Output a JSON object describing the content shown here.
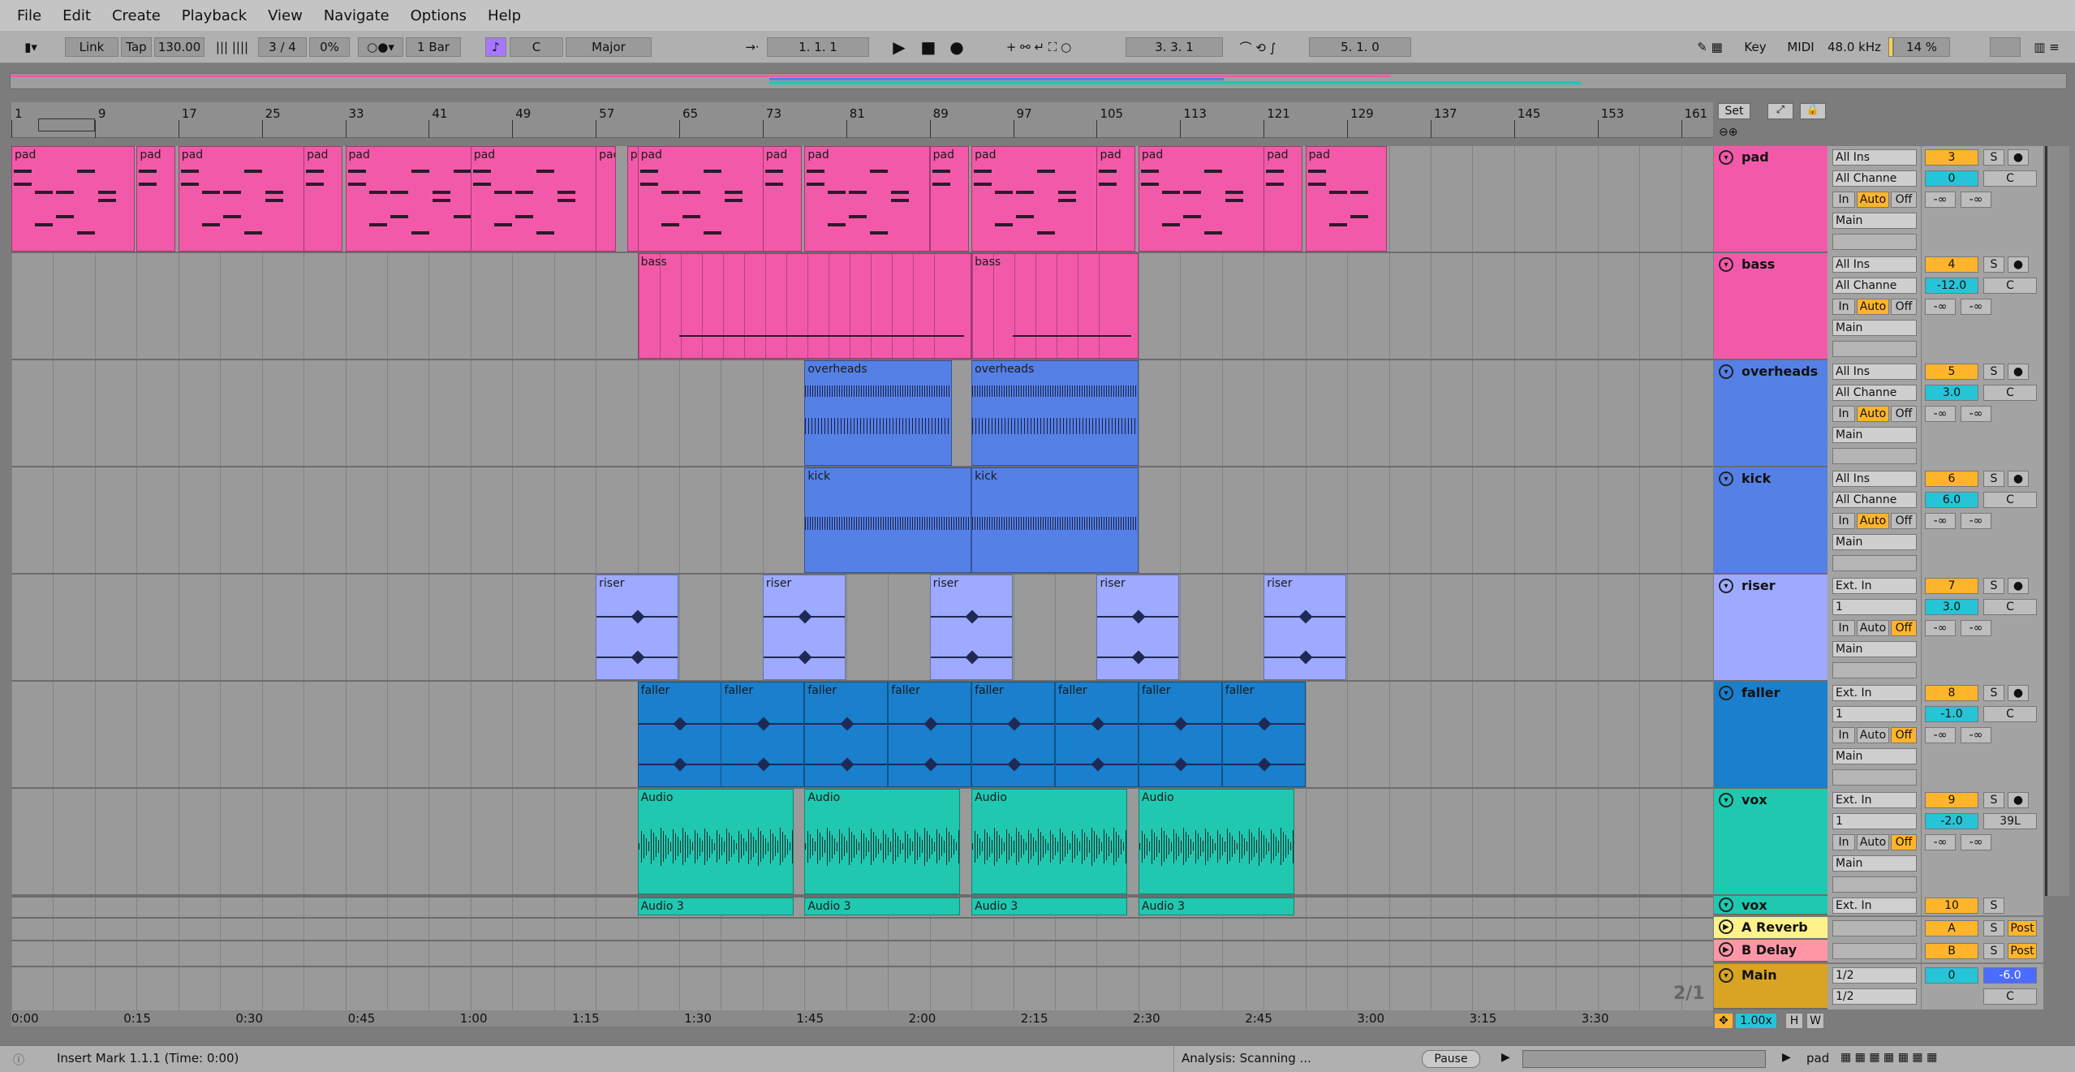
{
  "menu": [
    "File",
    "Edit",
    "Create",
    "Playback",
    "View",
    "Navigate",
    "Options",
    "Help"
  ],
  "toolbar": {
    "link": "Link",
    "tap": "Tap",
    "tempo": "130.00",
    "signature": "3 / 4",
    "groove": "0%",
    "quantize": "1 Bar",
    "key": "C",
    "scale": "Major",
    "position": "1.   1.   1",
    "loop_start": "3.   3.   1",
    "loop_length": "5.   1.   0",
    "key_map": "Key",
    "midi_map": "MIDI",
    "sample_rate": "48.0 kHz",
    "cpu": "14 %"
  },
  "ruler": {
    "bars": [
      "1",
      "9",
      "17",
      "25",
      "33",
      "41",
      "49",
      "57",
      "65",
      "73",
      "81",
      "89",
      "97",
      "105",
      "113",
      "121",
      "129",
      "137",
      "145",
      "153",
      "161"
    ],
    "set_label": "Set"
  },
  "timeline": [
    "0:00",
    "0:15",
    "0:30",
    "0:45",
    "1:00",
    "1:15",
    "1:30",
    "1:45",
    "2:00",
    "2:15",
    "2:30",
    "2:45",
    "3:00",
    "3:15",
    "3:30"
  ],
  "tracks": [
    {
      "name": "pad",
      "input": "All Ins",
      "channel": "All Channe",
      "monitor_in": "In",
      "monitor_auto": "Auto",
      "monitor_off": "Off",
      "output": "Main",
      "number": "3",
      "solo": "S",
      "volume": "0",
      "pan": "C",
      "send_a": "-∞",
      "send_b": "-∞",
      "color": "#f25aa9"
    },
    {
      "name": "bass",
      "input": "All Ins",
      "channel": "All Channe",
      "monitor_in": "In",
      "monitor_auto": "Auto",
      "monitor_off": "Off",
      "output": "Main",
      "number": "4",
      "solo": "S",
      "volume": "-12.0",
      "pan": "C",
      "send_a": "-∞",
      "send_b": "-∞",
      "color": "#f25aa9"
    },
    {
      "name": "overheads",
      "input": "All Ins",
      "channel": "All Channe",
      "monitor_in": "In",
      "monitor_auto": "Auto",
      "monitor_off": "Off",
      "output": "Main",
      "number": "5",
      "solo": "S",
      "volume": "3.0",
      "pan": "C",
      "send_a": "-∞",
      "send_b": "-∞",
      "color": "#5580e6"
    },
    {
      "name": "kick",
      "input": "All Ins",
      "channel": "All Channe",
      "monitor_in": "In",
      "monitor_auto": "Auto",
      "monitor_off": "Off",
      "output": "Main",
      "number": "6",
      "solo": "S",
      "volume": "6.0",
      "pan": "C",
      "send_a": "-∞",
      "send_b": "-∞",
      "color": "#5580e6"
    },
    {
      "name": "riser",
      "input": "Ext. In",
      "channel": "1",
      "monitor_in": "In",
      "monitor_auto": "Auto",
      "monitor_off": "Off",
      "output": "Main",
      "number": "7",
      "solo": "S",
      "volume": "3.0",
      "pan": "C",
      "send_a": "-∞",
      "send_b": "-∞",
      "color": "#9daaff"
    },
    {
      "name": "faller",
      "input": "Ext. In",
      "channel": "1",
      "monitor_in": "In",
      "monitor_auto": "Auto",
      "monitor_off": "Off",
      "output": "Main",
      "number": "8",
      "solo": "S",
      "volume": "-1.0",
      "pan": "C",
      "send_a": "-∞",
      "send_b": "-∞",
      "color": "#1a7fcc"
    },
    {
      "name": "vox",
      "input": "Ext. In",
      "channel": "1",
      "monitor_in": "In",
      "monitor_auto": "Auto",
      "monitor_off": "Off",
      "output": "Main",
      "number": "9",
      "solo": "S",
      "volume": "-2.0",
      "pan": "39L",
      "send_a": "-∞",
      "send_b": "-∞",
      "color": "#20c8b0"
    }
  ],
  "vox_collapsed": {
    "name": "vox",
    "input": "Ext. In",
    "number": "10",
    "solo": "S"
  },
  "returns": [
    {
      "name": "A Reverb",
      "letter": "A",
      "solo": "S",
      "post": "Post",
      "color": "#fff28a"
    },
    {
      "name": "B Delay",
      "letter": "B",
      "solo": "S",
      "post": "Post",
      "color": "#ff96a8"
    }
  ],
  "main": {
    "name": "Main",
    "cue_out": "1/2",
    "main_out": "1/2",
    "volume": "0",
    "pan": "-6.0",
    "pan2": "C",
    "color": "#d9a423",
    "page": "2/1",
    "zoom": "1.00x",
    "h": "H",
    "w": "W"
  },
  "clips": {
    "pad": "pad",
    "bass": "bass",
    "overheads": "overheads",
    "kick": "kick",
    "riser": "riser",
    "faller": "faller",
    "audio": "Audio",
    "audio3": "Audio 3",
    "audio_short": "Au",
    "o": "o"
  },
  "status": {
    "message": "Insert Mark 1.1.1 (Time: 0:00)",
    "analysis": "Analysis: Scanning ...",
    "pause": "Pause",
    "device": "pad"
  }
}
